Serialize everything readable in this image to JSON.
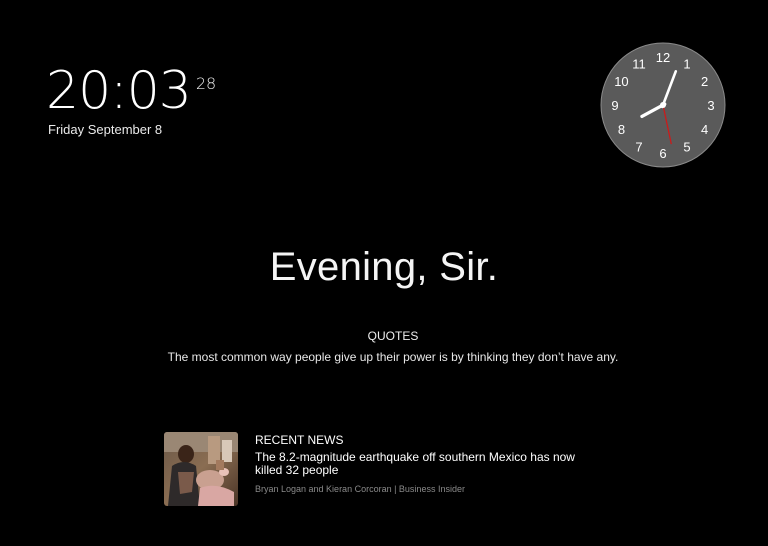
{
  "time": {
    "hours_minutes": "20:03",
    "seconds": "28",
    "date": "Friday September 8"
  },
  "analog_clock": {
    "numbers": [
      "12",
      "1",
      "2",
      "3",
      "4",
      "5",
      "6",
      "7",
      "8",
      "9",
      "10",
      "11"
    ],
    "hour": 20,
    "minute": 3,
    "second": 28,
    "face_color": "#5a5a5a",
    "second_hand_color": "#cc1a1a"
  },
  "greeting": "Evening, Sir.",
  "quotes": {
    "label": "QUOTES",
    "text": "The most common way people give up their power is by thinking they don’t have any."
  },
  "news": {
    "label": "RECENT NEWS",
    "title": "The 8.2-magnitude earthquake off southern Mexico has now killed 32 people",
    "source": "Bryan Logan and Kieran Corcoran | Business Insider"
  }
}
